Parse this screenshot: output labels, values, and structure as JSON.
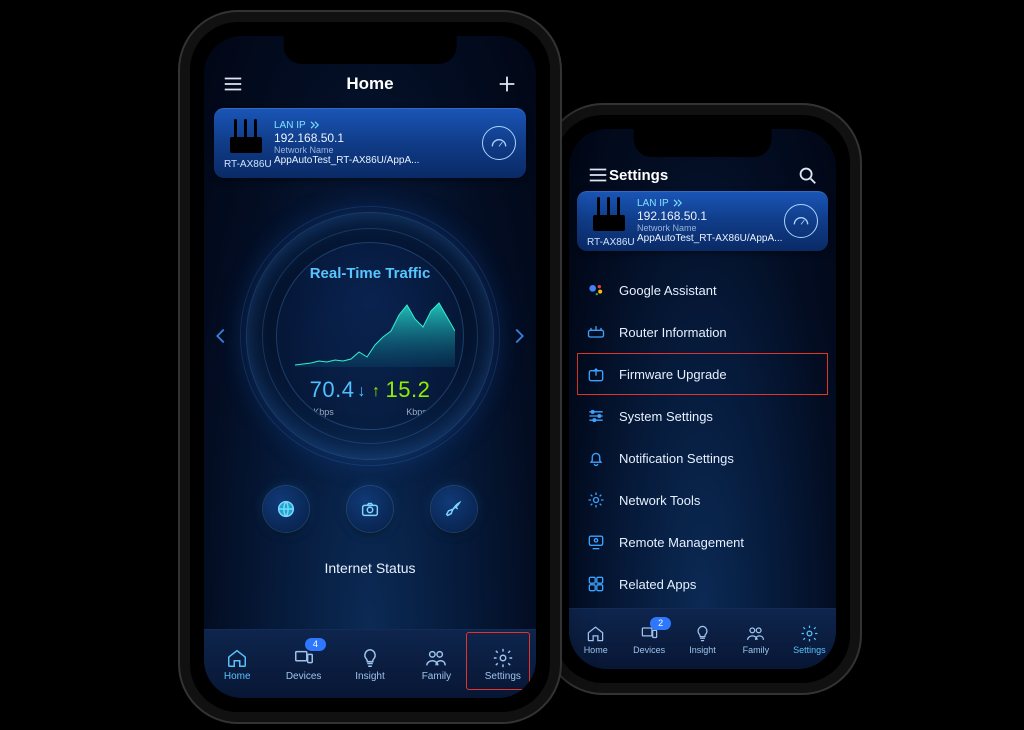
{
  "home": {
    "title": "Home",
    "card": {
      "lanip_label": "LAN IP",
      "ip": "192.168.50.1",
      "nn_label": "Network Name",
      "nn": "AppAutoTest_RT-AX86U/AppA...",
      "model": "RT-AX86U"
    },
    "dial_title": "Real-Time Traffic",
    "down_value": "70.4",
    "up_value": "15.2",
    "unit": "Kbps",
    "istat": "Internet Status",
    "nav": [
      "Home",
      "Devices",
      "Insight",
      "Family",
      "Settings"
    ],
    "devices_badge": "4"
  },
  "settings": {
    "title": "Settings",
    "card": {
      "lanip_label": "LAN IP",
      "ip": "192.168.50.1",
      "nn_label": "Network Name",
      "nn": "AppAutoTest_RT-AX86U/AppA...",
      "model": "RT-AX86U"
    },
    "items": [
      "Google Assistant",
      "Router Information",
      "Firmware Upgrade",
      "System Settings",
      "Notification Settings",
      "Network Tools",
      "Remote Management",
      "Related Apps"
    ],
    "nav": [
      "Home",
      "Devices",
      "Insight",
      "Family",
      "Settings"
    ],
    "devices_badge": "2"
  },
  "chart_data": {
    "type": "area",
    "title": "Real-Time Traffic",
    "x": [
      0,
      1,
      2,
      3,
      4,
      5,
      6,
      7,
      8,
      9,
      10,
      11,
      12,
      13,
      14,
      15,
      16,
      17,
      18,
      19
    ],
    "values": [
      2,
      3,
      4,
      6,
      5,
      7,
      6,
      8,
      20,
      12,
      30,
      45,
      55,
      80,
      90,
      72,
      60,
      85,
      92,
      70
    ],
    "ylabel": "Kbps",
    "ylim": [
      0,
      100
    ],
    "current_down_kbps": 70.4,
    "current_up_kbps": 15.2
  }
}
